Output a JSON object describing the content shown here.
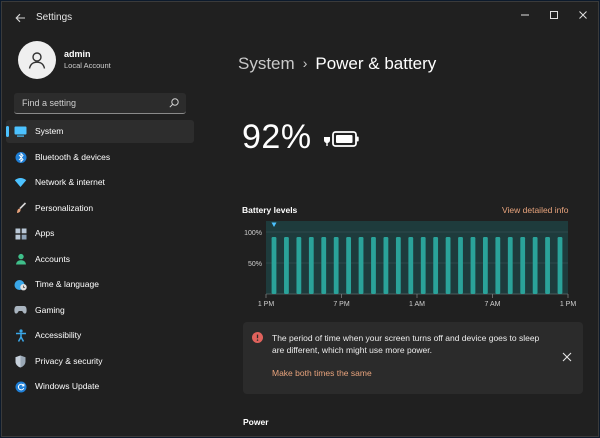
{
  "window": {
    "title": "Settings"
  },
  "profile": {
    "name": "admin",
    "account_type": "Local Account"
  },
  "search": {
    "placeholder": "Find a setting"
  },
  "sidebar": {
    "items": [
      {
        "label": "System",
        "icon": "system-icon",
        "active": true
      },
      {
        "label": "Bluetooth & devices",
        "icon": "bluetooth-icon",
        "active": false
      },
      {
        "label": "Network & internet",
        "icon": "wifi-icon",
        "active": false
      },
      {
        "label": "Personalization",
        "icon": "brush-icon",
        "active": false
      },
      {
        "label": "Apps",
        "icon": "apps-icon",
        "active": false
      },
      {
        "label": "Accounts",
        "icon": "accounts-icon",
        "active": false
      },
      {
        "label": "Time & language",
        "icon": "globe-clock-icon",
        "active": false
      },
      {
        "label": "Gaming",
        "icon": "gamepad-icon",
        "active": false
      },
      {
        "label": "Accessibility",
        "icon": "accessibility-icon",
        "active": false
      },
      {
        "label": "Privacy & security",
        "icon": "shield-icon",
        "active": false
      },
      {
        "label": "Windows Update",
        "icon": "update-icon",
        "active": false
      }
    ]
  },
  "header": {
    "parent": "System",
    "separator": "›",
    "current": "Power & battery"
  },
  "battery": {
    "percent": "92%"
  },
  "battery_levels": {
    "title": "Battery levels",
    "detail_link": "View detailed info"
  },
  "chart_data": {
    "type": "bar",
    "title": "Battery levels",
    "y_ticks": [
      "100%",
      "50%"
    ],
    "x_ticks": [
      "1 PM",
      "7 PM",
      "1 AM",
      "7 AM",
      "1 PM"
    ],
    "ylim": [
      0,
      100
    ],
    "values": [
      92,
      92,
      92,
      92,
      92,
      92,
      92,
      92,
      92,
      92,
      92,
      92,
      92,
      92,
      92,
      92,
      92,
      92,
      92,
      92,
      92,
      92,
      92,
      92
    ],
    "color": "#2aa39a"
  },
  "notice": {
    "message": "The period of time when your screen turns off and device goes to sleep are different, which might use more power.",
    "link": "Make both times the same"
  },
  "power": {
    "heading": "Power"
  },
  "colors": {
    "accent": "#4cc2ff",
    "link": "#e8a37c",
    "warning": "#e0625c",
    "bar": "#2aa39a"
  }
}
